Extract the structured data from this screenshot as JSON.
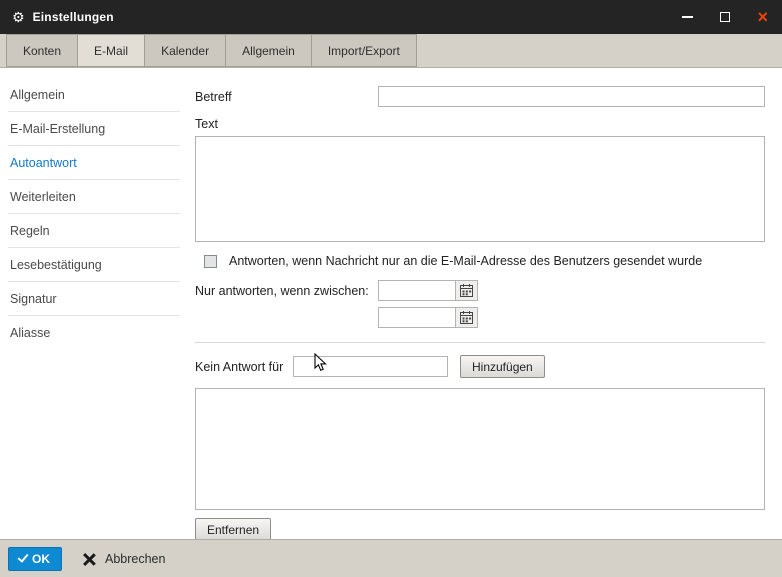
{
  "window": {
    "title": "Einstellungen"
  },
  "icons": {
    "gear": "⚙",
    "minimize": "bar-shape",
    "maximize": "square-outline",
    "close": "×",
    "ok_check": "check-shape",
    "cancel_x": "x-shape",
    "calendar": "calendar-grid",
    "cursor": "arrow-pointer"
  },
  "tabs": [
    {
      "label": "Konten",
      "active": false
    },
    {
      "label": "E-Mail",
      "active": true
    },
    {
      "label": "Kalender",
      "active": false
    },
    {
      "label": "Allgemein",
      "active": false
    },
    {
      "label": "Import/Export",
      "active": false
    }
  ],
  "sidebar": {
    "active_item": "Autoantwort",
    "items": [
      {
        "label": "Allgemein",
        "active": false
      },
      {
        "label": "E-Mail-Erstellung",
        "active": false
      },
      {
        "label": "Autoantwort",
        "active": true
      },
      {
        "label": "Weiterleiten",
        "active": false
      },
      {
        "label": "Regeln",
        "active": false
      },
      {
        "label": "Lesebestätigung",
        "active": false
      },
      {
        "label": "Signatur",
        "active": false
      },
      {
        "label": "Aliasse",
        "active": false
      }
    ]
  },
  "form": {
    "subject_label": "Betreff",
    "subject_value": "",
    "text_label": "Text",
    "text_value": "",
    "checkbox_label": "Antworten, wenn Nachricht nur an die E-Mail-Adresse des Benutzers gesendet wurde",
    "checkbox_checked": false,
    "range_label": "Nur antworten, wenn zwischen:",
    "date_from": "",
    "date_to": "",
    "no_reply_label": "Kein Antwort für",
    "no_reply_value": "",
    "add_button_label": "Hinzufügen",
    "remove_button_label": "Entfernen",
    "list_items": []
  },
  "footer": {
    "ok_label": "OK",
    "cancel_label": "Abbrechen"
  },
  "colors": {
    "titlebar": "#242424",
    "tabbar_bg": "#d5d1c9",
    "accent_blue": "#0d8ad2",
    "selected_nav_blue": "#1379c8",
    "close_x_red": "#e8430f"
  }
}
